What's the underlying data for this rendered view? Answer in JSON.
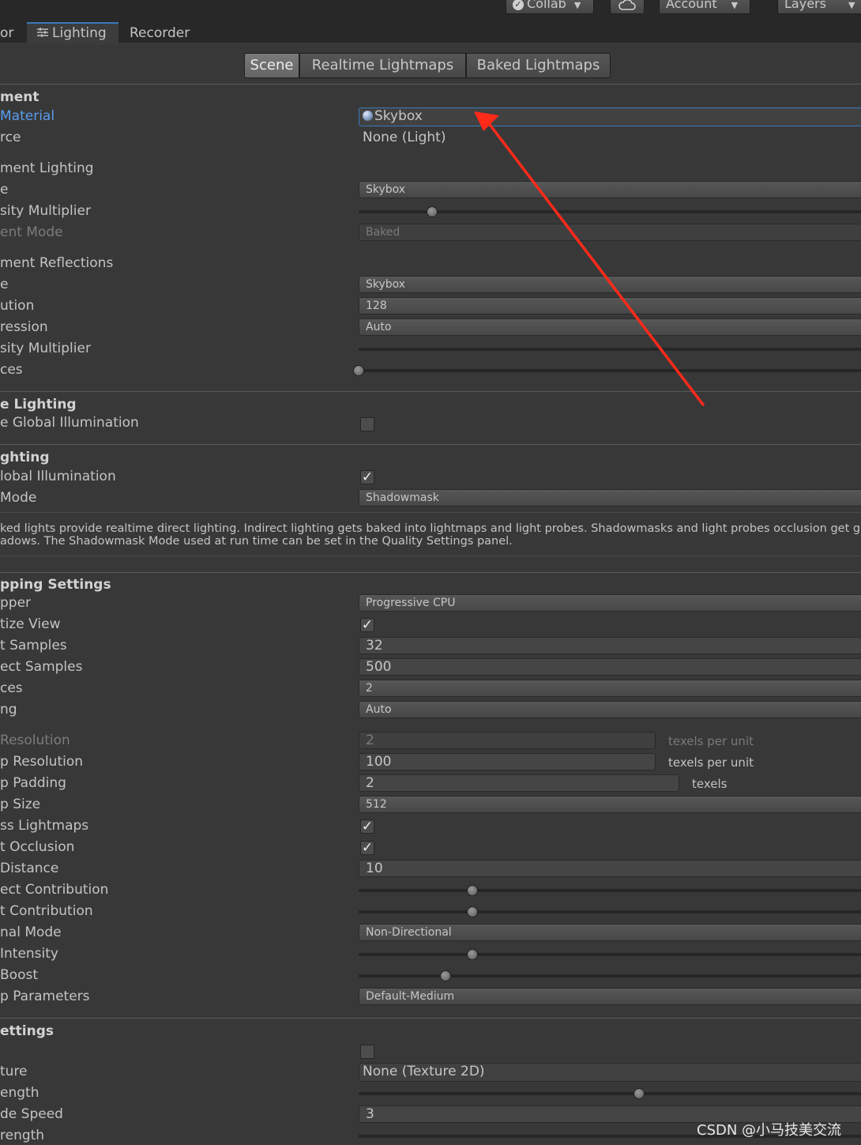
{
  "toolbar": {
    "collab_label": "Collab",
    "cloud_icon": "cloud-icon",
    "account_label": "Account",
    "layers_label": "Layers"
  },
  "tabs": [
    {
      "label": "or"
    },
    {
      "label": "Lighting"
    },
    {
      "label": "Recorder"
    }
  ],
  "segments": [
    "Scene",
    "Realtime Lightmaps",
    "Baked Lightmaps"
  ],
  "environment": {
    "header": "ment",
    "skybox_material_label": "Material",
    "skybox_material_value": "Skybox",
    "sun_source_label": "rce",
    "sun_source_value": "None (Light)",
    "env_lighting_label": "ment Lighting",
    "source_label": "e",
    "source_value": "Skybox",
    "intensity_label": "sity Multiplier",
    "intensity_fraction": 0.145,
    "ambient_mode_label": "ent Mode",
    "ambient_mode_value": "Baked",
    "env_reflections_label": "ment Reflections",
    "refl_source_label": "e",
    "refl_source_value": "Skybox",
    "resolution_label": "ution",
    "resolution_value": "128",
    "compression_label": "ression",
    "compression_value": "Auto",
    "refl_intensity_label": "sity Multiplier",
    "bounces_label": "ces",
    "bounces_fraction": 0.0
  },
  "realtime": {
    "header": "e Lighting",
    "gi_label": "e Global Illumination",
    "gi_checked": false
  },
  "mixed": {
    "header": "ghting",
    "baked_gi_label": "lobal Illumination",
    "baked_gi_checked": true,
    "mode_label": " Mode",
    "mode_value": "Shadowmask",
    "help_line1": "ked lights provide realtime direct lighting. Indirect lighting gets baked into lightmaps and light probes. Shadowmasks and light probes occlusion get genera",
    "help_line2": "adows. The Shadowmask Mode used at run time can be set in the Quality Settings panel."
  },
  "lightmapping": {
    "header": "pping Settings",
    "lightmapper_label": "pper",
    "lightmapper_value": "Progressive CPU",
    "prioritize_label": "tize View",
    "prioritize_checked": true,
    "direct_samples_label": "t Samples",
    "direct_samples_value": "32",
    "indirect_samples_label": "ect Samples",
    "indirect_samples_value": "500",
    "bounces_label": "ces",
    "bounces_value": "2",
    "filtering_label": "ng",
    "filtering_value": "Auto",
    "indirect_res_label": " Resolution",
    "indirect_res_value": "2",
    "indirect_res_unit": "texels per unit",
    "lightmap_res_label": "p Resolution",
    "lightmap_res_value": "100",
    "lightmap_res_unit": "texels per unit",
    "padding_label": "p Padding",
    "padding_value": "2",
    "padding_unit": "texels",
    "size_label": "p Size",
    "size_value": "512",
    "compress_label": "ss Lightmaps",
    "compress_checked": true,
    "ao_label": "t Occlusion",
    "ao_checked": true,
    "max_distance_label": "Distance",
    "max_distance_value": "10",
    "indirect_contrib_label": "ect Contribution",
    "indirect_contrib_fraction": 0.225,
    "direct_contrib_label": "t Contribution",
    "direct_contrib_fraction": 0.225,
    "directional_label": "nal Mode",
    "directional_value": "Non-Directional",
    "indirect_intensity_label": " Intensity",
    "indirect_intensity_fraction": 0.225,
    "albedo_boost_label": "Boost",
    "albedo_boost_fraction": 0.172,
    "params_label": "p Parameters",
    "params_value": "Default-Medium"
  },
  "other": {
    "header": "ettings",
    "fog_checked": false,
    "texture_label": "ture",
    "texture_value": "None (Texture 2D)",
    "strength_label": "ength",
    "strength_fraction": 0.555,
    "fade_speed_label": "de Speed",
    "fade_speed_value": "3",
    "strength2_label": "rength"
  },
  "watermark": "CSDN @小马技美交流",
  "colors": {
    "annotation_arrow": "#ff2a1a",
    "link_blue": "#5a9cf0",
    "tab_accent": "#3a79bb"
  }
}
